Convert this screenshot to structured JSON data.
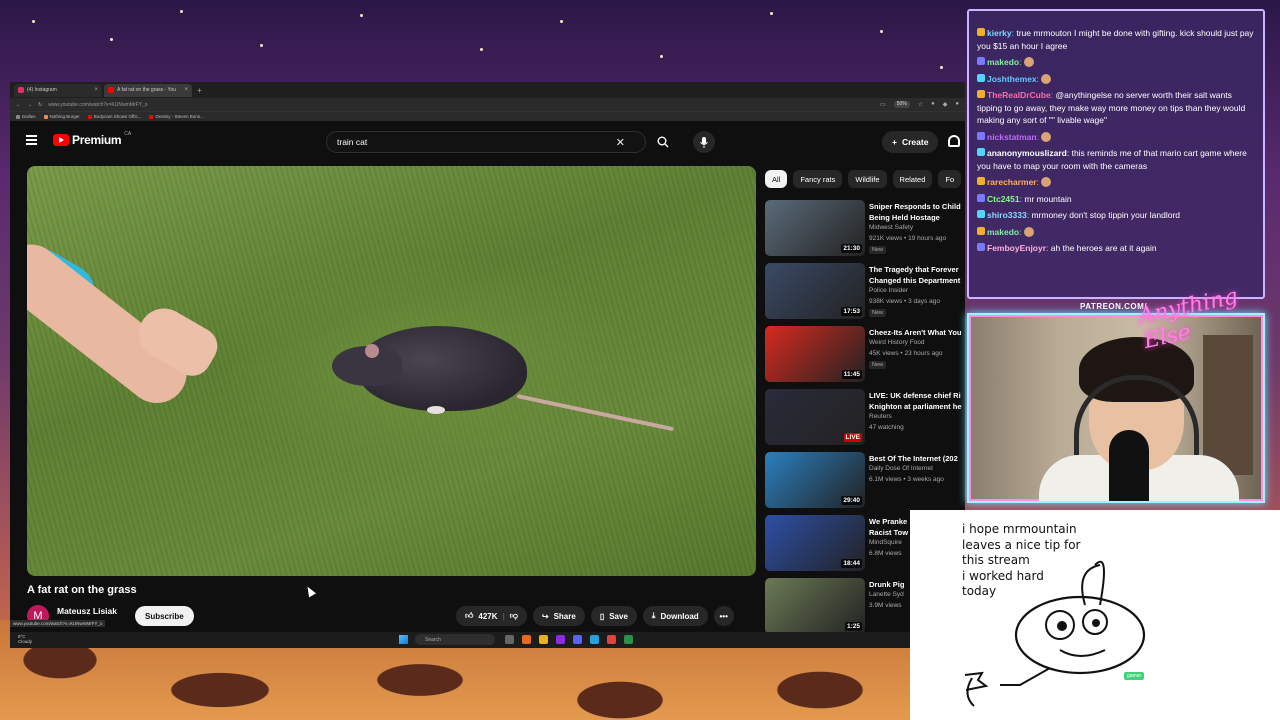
{
  "browser": {
    "tabs": [
      {
        "label": "(4) Instagram",
        "active": false
      },
      {
        "label": "A fat rat on the grass - You",
        "active": true
      }
    ],
    "url": "www.youtube.com/watch?v=KUNwmMrFY_o",
    "zoom": "50%",
    "bookmarks": [
      "Dailies",
      "Nothing Burger",
      "Bodycam Shows Offic...",
      "Destiny - Steven Bonn..."
    ],
    "status_url": "www.youtube.com/watch?v=KUNwmMrFY_o"
  },
  "youtube": {
    "logo_text": "Premium",
    "logo_region": "CA",
    "search_value": "train cat",
    "create_label": "Create",
    "video": {
      "title": "A fat rat on the grass",
      "channel": "Mateusz Lisiak",
      "channel_initial": "M",
      "subscribe_label": "Subscribe",
      "likes": "427K",
      "share_label": "Share",
      "save_label": "Save",
      "download_label": "Download"
    },
    "chips": [
      "All",
      "Fancy rats",
      "Wildlife",
      "Related",
      "Fo"
    ],
    "recommendations": [
      {
        "title": "Sniper Responds to Child",
        "title2": "Being Held Hostage",
        "channel": "Midwest Safety",
        "meta": "921K views • 19 hours ago",
        "badge": "New",
        "duration": "21:30",
        "thumb": "#5b6b7a"
      },
      {
        "title": "The Tragedy that Forever",
        "title2": "Changed this Department",
        "channel": "Police Insider",
        "meta": "938K views • 3 days ago",
        "badge": "New",
        "duration": "17:53",
        "thumb": "#3a4a66"
      },
      {
        "title": "Cheez-Its Aren't What You",
        "title2": "",
        "channel": "Weird History Food",
        "meta": "45K views • 23 hours ago",
        "badge": "New",
        "duration": "11:45",
        "thumb": "#d62a1f"
      },
      {
        "title": "LIVE: UK defense chief Ri",
        "title2": "Knighton at parliament he",
        "channel": "Reuters",
        "meta": "47 watching",
        "badge": "",
        "duration": "LIVE",
        "thumb": "#2a2a3a"
      },
      {
        "title": "Best Of The Internet (202",
        "title2": "",
        "channel": "Daily Dose Of Internet",
        "meta": "6.1M views • 3 weeks ago",
        "badge": "",
        "duration": "29:40",
        "thumb": "#2b7fc0"
      },
      {
        "title": "We Pranke",
        "title2": "Racist Tow",
        "channel": "MindSquire",
        "meta": "6.8M views",
        "badge": "",
        "duration": "18:44",
        "thumb": "#2d4fa8"
      },
      {
        "title": "Drunk Pig",
        "title2": "",
        "channel": "Lanette Syd",
        "meta": "3.9M views",
        "badge": "",
        "duration": "1:25",
        "thumb": "#6b7a55"
      }
    ]
  },
  "taskbar": {
    "weather_temp": "8°C",
    "weather_desc": "Cloudy",
    "search_label": "Search"
  },
  "chat": {
    "messages": [
      {
        "user": "kierky",
        "color": "#7fd8ff",
        "text": "true mrmouton I might be done with gifting. kick should just pay you $15 an hour I agree"
      },
      {
        "user": "makedo",
        "color": "#7ff0a0",
        "text": ""
      },
      {
        "user": "Joshthemex",
        "color": "#5fc8ff",
        "text": ""
      },
      {
        "user": "TheRealDrCube",
        "color": "#ff6aa8",
        "text": "@anythingelse no server worth their salt wants tipping to go away, they make way more money on tips than they would making any sort of \"\" livable wage\""
      },
      {
        "user": "nickstatman",
        "color": "#c06aff",
        "text": ""
      },
      {
        "user": "ananonymouslizard",
        "color": "#ffffff",
        "text": "this reminds me of that mario cart game where you have to map your room with the cameras"
      },
      {
        "user": "rarecharmer",
        "color": "#ffb060",
        "text": ""
      },
      {
        "user": "Ctc2451",
        "color": "#7fff7f",
        "text": "mr mountain"
      },
      {
        "user": "shiro3333",
        "color": "#8ad8ff",
        "text": "mrmoney don't stop tippin your landlord"
      },
      {
        "user": "makedo",
        "color": "#7ff0a0",
        "text": ""
      },
      {
        "user": "FemboyEnjoyr",
        "color": "#ffb0e0",
        "text": "ah the heroes are at it again"
      }
    ]
  },
  "overlay": {
    "patreon": "PATREON.COM/",
    "neon": "Anything Else"
  },
  "drawing": {
    "lines": [
      "i hope mrmountain",
      "leaves a nice tip for",
      "this stream",
      "i worked hard",
      "today"
    ],
    "gamer_tag": "gamer"
  }
}
